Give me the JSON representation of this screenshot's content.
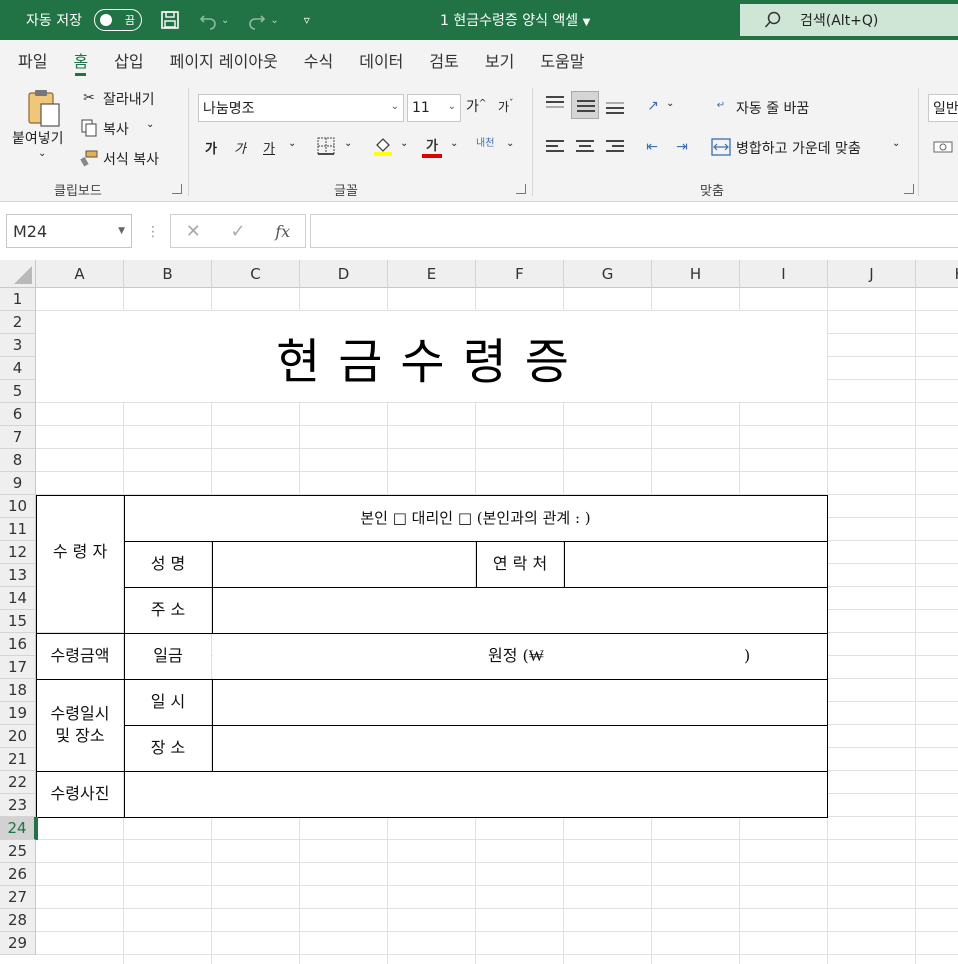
{
  "titlebar": {
    "autosave_label": "자동 저장",
    "autosave_state": "끔",
    "doc_title": "1 현금수령증 양식 액셀",
    "search_label": "검색(Alt+Q)"
  },
  "tabs": [
    "파일",
    "홈",
    "삽입",
    "페이지 레이아웃",
    "수식",
    "데이터",
    "검토",
    "보기",
    "도움말"
  ],
  "active_tab": "홈",
  "ribbon": {
    "clipboard": {
      "paste": "붙여넣기",
      "cut": "잘라내기",
      "copy": "복사",
      "format_painter": "서식 복사",
      "group_label": "클립보드"
    },
    "font": {
      "font_name": "나눔명조",
      "font_size": "11",
      "bold": "가",
      "italic": "가",
      "underline": "가",
      "font_color_glyph": "가",
      "phonetic": "내천",
      "group_label": "글꼴",
      "grow": "가",
      "shrink": "가"
    },
    "alignment": {
      "wrap_text": "자동 줄 바꿈",
      "merge_center": "병합하고 가운데 맞춤",
      "group_label": "맞춤"
    },
    "number": {
      "format": "일반"
    }
  },
  "formula_bar": {
    "name_box": "M24",
    "fx": "fx",
    "value": ""
  },
  "sheet": {
    "columns": [
      "A",
      "B",
      "C",
      "D",
      "E",
      "F",
      "G",
      "H",
      "I",
      "J",
      "K"
    ],
    "rows": [
      "1",
      "2",
      "3",
      "4",
      "5",
      "6",
      "7",
      "8",
      "9",
      "10",
      "11",
      "12",
      "13",
      "14",
      "15",
      "16",
      "17",
      "18",
      "19",
      "20",
      "21",
      "22",
      "23",
      "24",
      "25",
      "26",
      "27",
      "28",
      "29"
    ],
    "selected_row": "24"
  },
  "form": {
    "title": "현금수령증",
    "principal_line": "본인 □ 대리인 □ (본인과의 관계 : )",
    "recipient": "수 령 자",
    "name": "성    명",
    "contact": "연 락 처",
    "address": "주    소",
    "amount_label": "수령금액",
    "amount_prefix": "일금",
    "amount_won": "원정 (₩",
    "amount_close": ")",
    "datetime_label": "수령일시\n및 장소",
    "datetime_label_1": "수령일시",
    "datetime_label_2": "및 장소",
    "date_time": "일    시",
    "place": "장    소",
    "photo": "수령사진"
  },
  "colors": {
    "excel_green": "#217346"
  }
}
